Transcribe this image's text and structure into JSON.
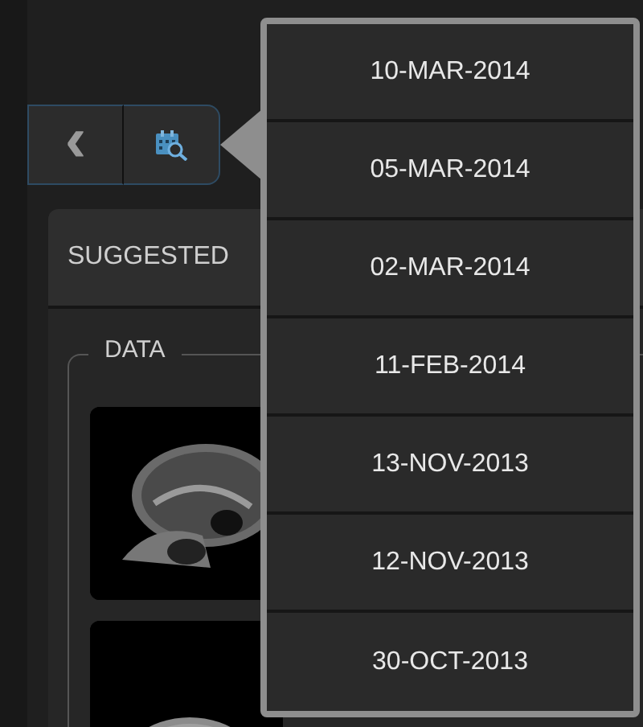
{
  "toolbar": {
    "back_button": "‹"
  },
  "panel": {
    "title": "SUGGESTED",
    "group_label": "DATA"
  },
  "date_menu": {
    "dates": [
      "10-MAR-2014",
      "05-MAR-2014",
      "02-MAR-2014",
      "11-FEB-2014",
      "13-NOV-2013",
      "12-NOV-2013",
      "30-OCT-2013"
    ]
  }
}
